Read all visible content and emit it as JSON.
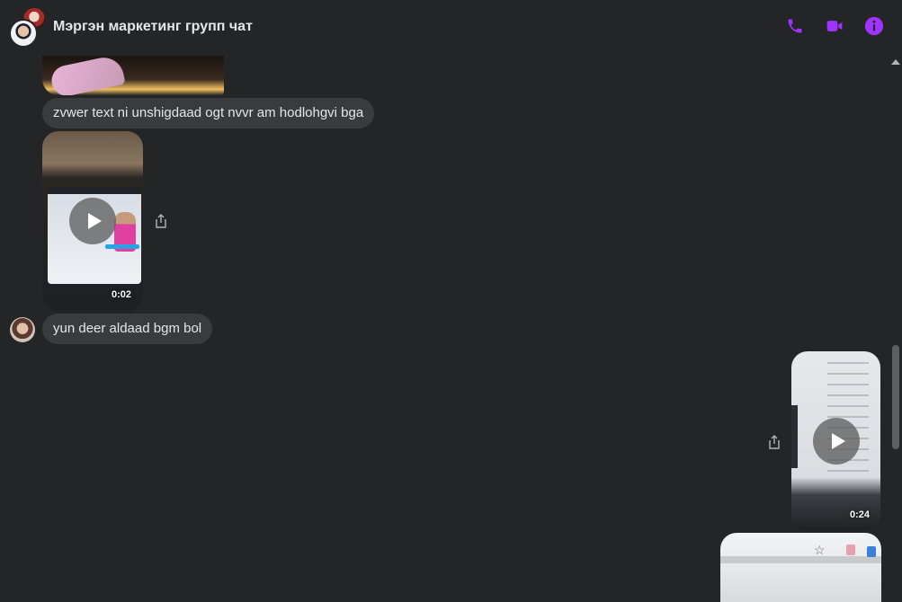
{
  "header": {
    "title": "Мэргэн маркетинг групп чат",
    "accent_color": "#a033ff",
    "actions": [
      "phone-icon",
      "video-camera-icon",
      "info-icon"
    ]
  },
  "messages": [
    {
      "type": "image",
      "sender": "other"
    },
    {
      "type": "text",
      "sender": "other",
      "text": "zvwer text ni unshigdaad ogt nvvr am hodlohgvi bga"
    },
    {
      "type": "video",
      "sender": "other",
      "duration": "0:02"
    },
    {
      "type": "text",
      "sender": "other",
      "text": "yun deer aldaad bgm bol"
    },
    {
      "type": "video",
      "sender": "self",
      "duration": "0:24"
    },
    {
      "type": "image",
      "sender": "self"
    }
  ]
}
